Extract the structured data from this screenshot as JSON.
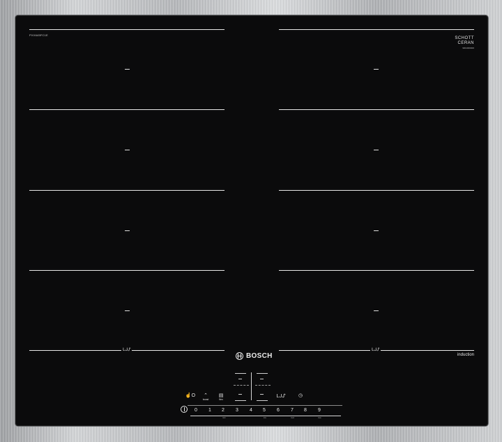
{
  "frame": {
    "glass_color": "#0b0b0c",
    "trim_color": "#c2c4c6"
  },
  "model_code": "PXX645FC1E",
  "schott": {
    "brand": "SCHOTT",
    "sub": "CERAN",
    "code": "9001000000"
  },
  "brand": {
    "name": "BOSCH"
  },
  "induction_label": "induction",
  "zones": {
    "mark": "–",
    "flex_icon_left": "ᒪᒍᔑ",
    "flex_icon_right": "ᒪᒍᔑ"
  },
  "displays": {
    "upper_left": "–",
    "upper_right": "–",
    "lower_left": "–",
    "lower_right": "–"
  },
  "controls": {
    "childlock_symbol": "☝O",
    "boost_symbol": "⌃",
    "boost_label": "boost",
    "flex_symbol": "▤",
    "flex_label": "flex",
    "flex2_symbol": "ᒪᒍᔑ",
    "timer_symbol": "◷"
  },
  "power_scale": {
    "numbers": [
      "0",
      "1",
      "2",
      "3",
      "4",
      "5",
      "6",
      "7",
      "8",
      "9"
    ],
    "sub_labels": [
      "",
      "",
      "mini",
      "",
      "",
      "low",
      "",
      "med",
      "",
      "max"
    ]
  }
}
